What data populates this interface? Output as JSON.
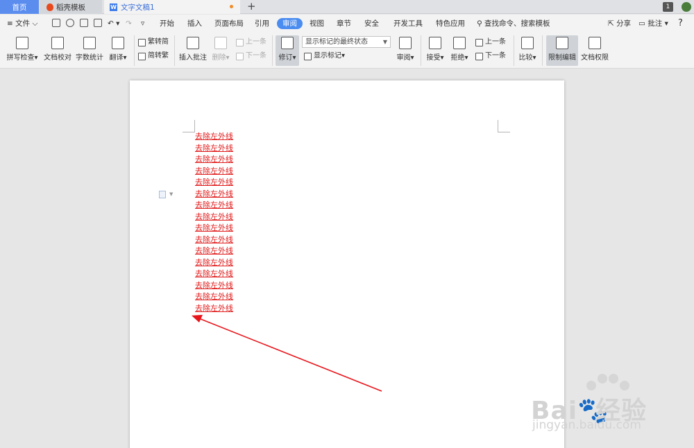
{
  "tabs": [
    {
      "label": "首页"
    },
    {
      "label": "稻壳模板"
    },
    {
      "label": "文字文稿1"
    }
  ],
  "tab_add": "+",
  "page_badge": "1",
  "menu": {
    "file": "文件",
    "items": [
      "开始",
      "插入",
      "页面布局",
      "引用",
      "审阅",
      "视图",
      "章节",
      "安全",
      "开发工具",
      "特色应用"
    ],
    "active": "审阅",
    "search": "查找命令、搜索模板",
    "share": "分享",
    "comment": "批注",
    "help": "?"
  },
  "ribbon": {
    "spell_check": "拼写检查",
    "doc_proof": "文档校对",
    "word_count": "字数统计",
    "translate": "翻译",
    "trad_to_simp": "繁转简",
    "simp_to_trad": "简转繁",
    "insert_comment": "插入批注",
    "delete": "删除",
    "prev_item": "上一条",
    "next_item": "下一条",
    "revise": "修订",
    "display_state": "显示标记的最终状态",
    "show_markup": "显示标记",
    "review": "审阅",
    "accept": "接受",
    "reject": "拒绝",
    "prev": "上一条",
    "next": "下一条",
    "compare": "比较",
    "restrict_edit": "限制编辑",
    "doc_permission": "文档权限"
  },
  "document": {
    "lines": [
      "去除左外线",
      "去除左外线",
      "去除左外线",
      "去除左外线",
      "去除左外线",
      "去除左外线",
      "去除左外线",
      "去除左外线",
      "去除左外线",
      "去除左外线",
      "去除左外线",
      "去除左外线",
      "去除左外线",
      "去除左外线",
      "去除左外线",
      "去除左外线"
    ],
    "text_color": "#e01818"
  },
  "watermark": {
    "brand_latin": "Bai",
    "brand_cn": "经验",
    "url": "jingyan.baidu.com"
  },
  "annotation_color": "#e8141a"
}
